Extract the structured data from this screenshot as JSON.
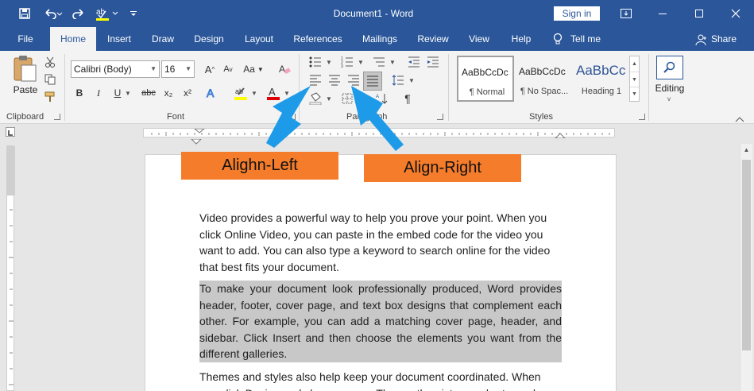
{
  "titlebar": {
    "doc_title": "Document1 - Word",
    "signin": "Sign in",
    "qat_icons": [
      "save-icon",
      "undo-icon",
      "redo-icon",
      "spelling-icon",
      "customize-icon"
    ],
    "window_icons": [
      "ribbon-display-icon",
      "minimize-icon",
      "maximize-icon",
      "close-icon"
    ]
  },
  "tabs": [
    "File",
    "Home",
    "Insert",
    "Draw",
    "Design",
    "Layout",
    "References",
    "Mailings",
    "Review",
    "View",
    "Help"
  ],
  "active_tab": "Home",
  "tell_me": "Tell me",
  "share": "Share",
  "ribbon": {
    "clipboard": {
      "paste": "Paste",
      "label": "Clipboard"
    },
    "font": {
      "family": "Calibri (Body)",
      "size": "16",
      "label": "Font",
      "aa": "Aa",
      "bold": "B",
      "italic": "I",
      "underline": "U",
      "strike": "abc",
      "sub": "x₂",
      "sup": "x²",
      "highlight_color": "#ffff00",
      "font_color": "#e00000"
    },
    "paragraph": {
      "label": "Paragraph"
    },
    "styles": {
      "label": "Styles",
      "items": [
        {
          "preview": "AaBbCcDc",
          "name": "¶ Normal"
        },
        {
          "preview": "AaBbCcDc",
          "name": "¶ No Spac..."
        },
        {
          "preview": "AaBbCc",
          "name": "Heading 1"
        }
      ]
    },
    "editing": {
      "label": "Editing"
    }
  },
  "callouts": {
    "left": "Alighn-Left",
    "right": "Align-Right",
    "color": "#f47c2a",
    "arrow_color": "#1e9be8"
  },
  "document": {
    "para1": "Video provides a powerful way to help you prove your point. When you click Online Video, you can paste in the embed code for the video you want to add. You can also type a keyword to search online for the video that best fits your document.",
    "para2": "To make your document look professionally produced, Word provides header, footer, cover page, and text box designs that complement each other. For example, you can add a matching cover page, header, and sidebar. Click Insert and then choose the elements you want from the different galleries.",
    "para3": "Themes and styles also help keep your document coordinated. When you click Design and choose a new Theme, the pictures, charts, and"
  }
}
